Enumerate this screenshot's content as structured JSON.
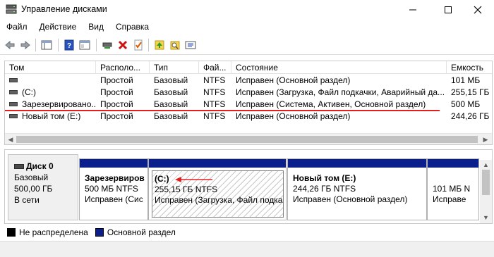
{
  "window": {
    "title": "Управление дисками"
  },
  "menu": [
    "Файл",
    "Действие",
    "Вид",
    "Справка"
  ],
  "columns": [
    "Том",
    "Располо...",
    "Тип",
    "Фай...",
    "Состояние",
    "Емкость"
  ],
  "volumes": [
    {
      "name": "",
      "layout": "Простой",
      "type": "Базовый",
      "fs": "NTFS",
      "status": "Исправен (Основной раздел)",
      "capacity": "101 МБ"
    },
    {
      "name": "(C:)",
      "layout": "Простой",
      "type": "Базовый",
      "fs": "NTFS",
      "status": "Исправен (Загрузка, Файл подкачки, Аварийный да...",
      "capacity": "255,15 ГБ"
    },
    {
      "name": "Зарезервировано...",
      "layout": "Простой",
      "type": "Базовый",
      "fs": "NTFS",
      "status": "Исправен (Система, Активен, Основной раздел)",
      "capacity": "500 МБ"
    },
    {
      "name": "Новый том (E:)",
      "layout": "Простой",
      "type": "Базовый",
      "fs": "NTFS",
      "status": "Исправен (Основной раздел)",
      "capacity": "244,26 ГБ"
    }
  ],
  "disk": {
    "name": "Диск 0",
    "type": "Базовый",
    "size": "500,00 ГБ",
    "state": "В сети"
  },
  "partitions": [
    {
      "name": "Зарезервиров",
      "size": "500 МБ NTFS",
      "status": "Исправен (Сис"
    },
    {
      "name": "(C:)",
      "size": "255,15 ГБ NTFS",
      "status": "Исправен (Загрузка, Файл подкач"
    },
    {
      "name": "Новый том  (E:)",
      "size": "244,26 ГБ NTFS",
      "status": "Исправен (Основной раздел)"
    },
    {
      "name": "",
      "size": "101 МБ N",
      "status": "Исправе"
    }
  ],
  "legend": [
    {
      "label": "Не распределена",
      "color": "#000000"
    },
    {
      "label": "Основной раздел",
      "color": "#0b1f8c"
    }
  ],
  "colors": {
    "accent_red": "#e02020",
    "partition_bar": "#0b1f8c"
  },
  "toolbar_icons": [
    "back-arrow-icon",
    "forward-arrow-icon",
    "console-tree-icon",
    "help-icon",
    "properties-icon",
    "connect-icon",
    "delete-icon",
    "check-icon",
    "up-folder-icon",
    "search-folder-icon",
    "settings-list-icon"
  ]
}
